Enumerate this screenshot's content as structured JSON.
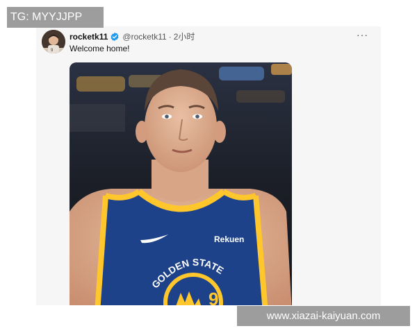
{
  "watermark": {
    "top_left": "TG: MYYJJPP",
    "bottom_right": "www.xiazai-kaiyuan.com"
  },
  "tweet": {
    "display_name": "rocketk11",
    "handle": "@rocketk11",
    "separator": "·",
    "time": "2小时",
    "text": "Welcome home!",
    "more_label": "···",
    "verified": true
  },
  "media": {
    "jersey_sponsor": "Rekuen",
    "jersey_team": "GOLDEN STATE",
    "jersey_number": "9"
  },
  "colors": {
    "verified_badge": "#1d9bf0",
    "jersey_blue": "#1d428a",
    "jersey_gold": "#ffc72c",
    "card_background": "#f6f6f7"
  }
}
